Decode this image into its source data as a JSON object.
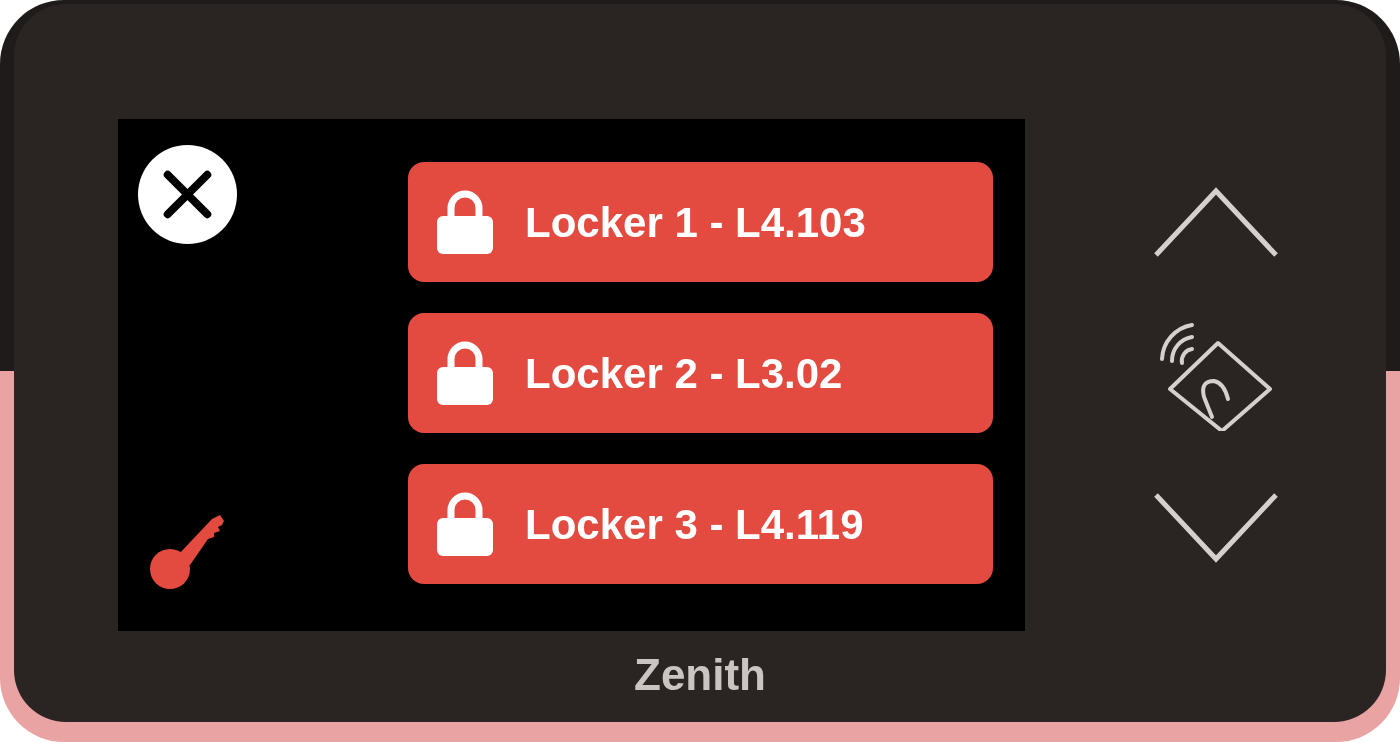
{
  "lockers": [
    {
      "label": "Locker 1 - L4.103"
    },
    {
      "label": "Locker 2 - L3.02"
    },
    {
      "label": "Locker 3 - L4.119"
    }
  ],
  "brand": "Zenith"
}
